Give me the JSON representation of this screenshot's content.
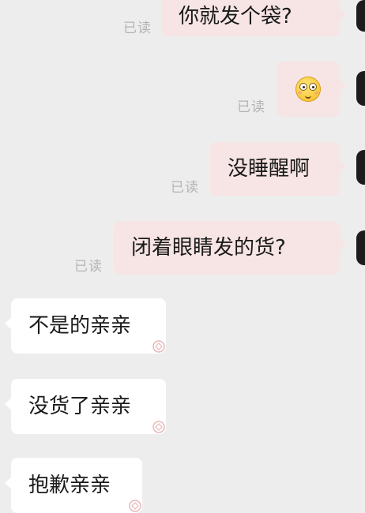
{
  "chat": {
    "read_label": "已读",
    "messages": [
      {
        "side": "out",
        "text": "你就发个袋?",
        "status": "已读"
      },
      {
        "side": "out",
        "text": "",
        "emoji": "flushed-smiling-emoji",
        "status": "已读"
      },
      {
        "side": "out",
        "text": "没睡醒啊",
        "status": "已读"
      },
      {
        "side": "out",
        "text": "闭着眼睛发的货?",
        "status": "已读"
      },
      {
        "side": "in",
        "text": "不是的亲亲"
      },
      {
        "side": "in",
        "text": "没货了亲亲"
      },
      {
        "side": "in",
        "text": "抱歉亲亲"
      }
    ]
  },
  "colors": {
    "background": "#ededed",
    "outgoing_bubble": "#f7e4e4",
    "incoming_bubble": "#ffffff",
    "read_text": "#b4b4b4"
  }
}
